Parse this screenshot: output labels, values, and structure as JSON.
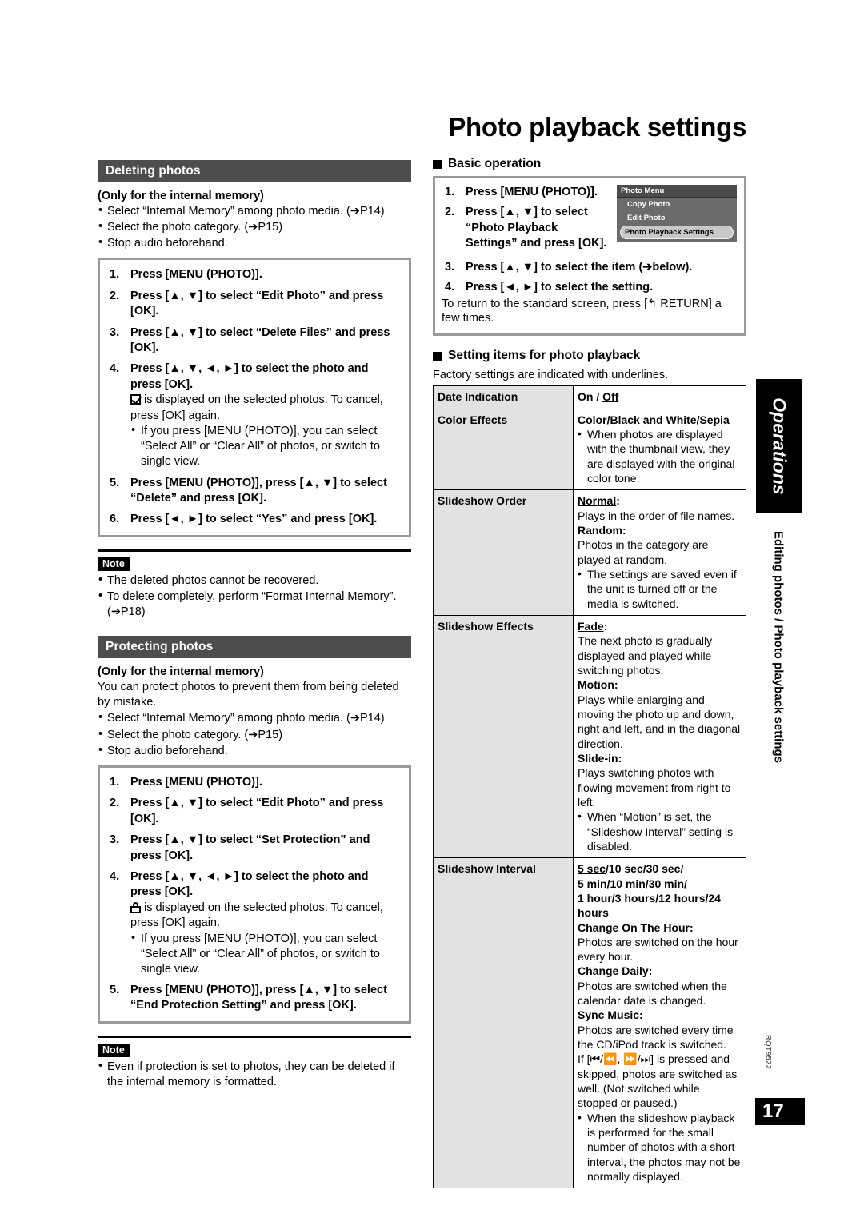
{
  "page": {
    "title": "Photo playback settings",
    "number": "17",
    "doc_code": "RQT9522",
    "rail_tab": "Operations",
    "rail_label": "Editing photos / Photo playback settings",
    "note_tag": "Note"
  },
  "deleting": {
    "header": "Deleting photos",
    "subhead": "(Only for the internal memory)",
    "prereqs": [
      "Select “Internal Memory” among photo media. (➔P14)",
      "Select the photo category. (➔P15)",
      "Stop audio beforehand."
    ],
    "steps": {
      "s1": "Press [MENU (PHOTO)].",
      "s2": "Press [▲, ▼] to select “Edit Photo” and press [OK].",
      "s3": "Press [▲, ▼] to select “Delete Files” and press [OK].",
      "s4": "Press [▲, ▼, ◄, ►] to select the photo and press [OK].",
      "s4_note": "is displayed on the selected photos. To cancel, press [OK] again.",
      "s4_bullet": "If you press [MENU (PHOTO)], you can select “Select All” or “Clear All” of photos, or switch to single view.",
      "s5": "Press [MENU (PHOTO)], press [▲, ▼] to select “Delete” and press [OK].",
      "s6": "Press [◄, ►] to select “Yes” and press [OK]."
    },
    "notes": [
      "The deleted photos cannot be recovered.",
      "To delete completely, perform “Format Internal Memory”. (➔P18)"
    ]
  },
  "protecting": {
    "header": "Protecting photos",
    "subhead": "(Only for the internal memory)",
    "intro": "You can protect photos to prevent them from being deleted by mistake.",
    "prereqs": [
      "Select “Internal Memory” among photo media. (➔P14)",
      "Select the photo category. (➔P15)",
      "Stop audio beforehand."
    ],
    "steps": {
      "s1": "Press [MENU (PHOTO)].",
      "s2": "Press [▲, ▼] to select “Edit Photo” and press [OK].",
      "s3": "Press [▲, ▼] to select “Set Protection” and press [OK].",
      "s4": "Press [▲, ▼, ◄, ►] to select the photo and press [OK].",
      "s4_note": "is displayed on the selected photos. To cancel, press [OK] again.",
      "s4_bullet": "If you press [MENU (PHOTO)], you can select “Select All” or “Clear All” of photos, or switch to single view.",
      "s5": "Press [MENU (PHOTO)], press [▲, ▼] to select “End Protection Setting” and press [OK]."
    },
    "notes": [
      "Even if protection is set to photos, they can be deleted if the internal memory is formatted."
    ]
  },
  "basic_operation": {
    "heading": "Basic operation",
    "steps": {
      "s1": "Press [MENU (PHOTO)].",
      "s2": "Press [▲, ▼] to select “Photo Playback Settings” and press [OK].",
      "s3": "Press [▲, ▼] to select the item (➔below).",
      "s4": "Press [◄, ►] to select the setting."
    },
    "tail": "To return to the standard screen, press [↰ RETURN] a few times.",
    "photo_menu": {
      "title": "Photo Menu",
      "items": [
        "Copy Photo",
        "Edit Photo"
      ],
      "selected": "Photo Playback Settings"
    }
  },
  "setting_items": {
    "heading": "Setting items for photo playback",
    "subtitle": "Factory settings are indicated with underlines.",
    "rows": [
      {
        "key": "Date Indication",
        "values_plain": "On / Off",
        "default": "Off"
      },
      {
        "key": "Color Effects",
        "options": "Color/Black and White/Sepia",
        "default": "Color",
        "bullets": [
          "When photos are displayed with the thumbnail view, they are displayed with the original color tone."
        ]
      },
      {
        "key": "Slideshow Order",
        "entries": [
          {
            "term": "Normal",
            "underline": true,
            "desc": "Plays in the order of file names."
          },
          {
            "term": "Random",
            "underline": false,
            "desc": "Photos in the category are played at random."
          }
        ],
        "bullets": [
          "The settings are saved even if the unit is turned off or the media is switched."
        ]
      },
      {
        "key": "Slideshow Effects",
        "entries": [
          {
            "term": "Fade",
            "underline": true,
            "desc": "The next photo is gradually displayed and played while switching photos."
          },
          {
            "term": "Motion",
            "underline": false,
            "desc": "Plays while enlarging and moving the photo up and down, right and left, and in the diagonal direction."
          },
          {
            "term": "Slide-in",
            "underline": false,
            "desc": "Plays switching photos with flowing movement from right to left."
          }
        ],
        "bullets": [
          "When “Motion” is set, the “Slideshow Interval” setting is disabled."
        ]
      },
      {
        "key": "Slideshow Interval",
        "option_lines": [
          "5 sec/10 sec/30 sec/",
          "5 min/10 min/30 min/",
          "1 hour/3 hours/12 hours/24 hours"
        ],
        "default": "5 sec",
        "entries": [
          {
            "term": "Change On The Hour",
            "underline": false,
            "desc": "Photos are switched on the hour every hour."
          },
          {
            "term": "Change Daily",
            "underline": false,
            "desc": "Photos are switched when the calendar date is changed."
          },
          {
            "term": "Sync Music",
            "underline": false,
            "desc": "Photos are switched every time the CD/iPod track is switched."
          }
        ],
        "extra": "If [⏮/⏪, ⏩/⏭] is pressed and skipped, photos are switched as well. (Not switched while stopped or paused.)",
        "bullets": [
          "When the slideshow playback is performed for the small number of photos with a short interval, the photos may not be normally displayed."
        ]
      }
    ]
  }
}
